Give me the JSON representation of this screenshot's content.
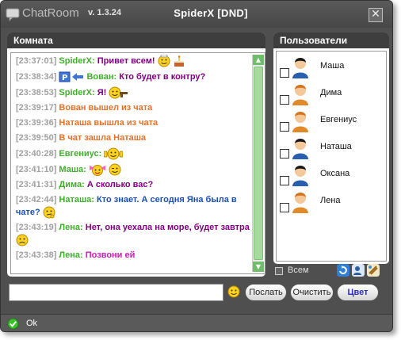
{
  "window": {
    "app_name": "ChatRoom",
    "version": "v. 1.3.24",
    "title_user": "SpiderX  [DND]",
    "close_glyph": "✕"
  },
  "room": {
    "title": "Комната",
    "messages": [
      {
        "time": "[23:37:01]",
        "nick": "SpiderX:",
        "text": "Привет всем!",
        "style": "purple",
        "icons": [
          "smiley-chef-icon",
          "cake-icon"
        ]
      },
      {
        "time": "[23:38:34]",
        "nick": "Вован:",
        "text": "Кто будет в контру?",
        "style": "purple",
        "prefix_icons": [
          "private-p-icon",
          "arrow-left-icon"
        ]
      },
      {
        "time": "[23:38:53]",
        "nick": "SpiderX:",
        "text": "Я!",
        "style": "purple",
        "icons": [
          "smiley-gun-icon"
        ]
      },
      {
        "time": "[23:39:17]",
        "text": "Вован вышел из чата",
        "style": "system"
      },
      {
        "time": "[23:39:36]",
        "text": "Наташа вышла из чата",
        "style": "system"
      },
      {
        "time": "[23:39:50]",
        "text": "В чат зашла Наташа",
        "style": "system"
      },
      {
        "time": "[23:40:28]",
        "nick": "Евгениус:",
        "text": "",
        "style": "purple",
        "icons": [
          "smiley-thumbs-up-icon"
        ]
      },
      {
        "time": "[23:41:10]",
        "nick": "Маша:",
        "text": "",
        "style": "purple",
        "icons": [
          "smiley-pink-bow-icon",
          "smiley-wink-icon"
        ]
      },
      {
        "time": "[23:41:31]",
        "nick": "Дима:",
        "text": "А сколько вас?",
        "style": "purple"
      },
      {
        "time": "[23:42:44]",
        "nick": "Наташа:",
        "text": "Кто знает. А сегодня Яна была в чате?",
        "style": "blue",
        "icons": [
          "smiley-thinking-icon"
        ]
      },
      {
        "time": "[23:43:19]",
        "nick": "Лена:",
        "text": "Нет, она уехала на море, будет завтра",
        "style": "purple",
        "icons": [
          "smiley-sad-icon"
        ]
      },
      {
        "time": "[23:43:38]",
        "nick": "Лена:",
        "text": "Позвони ей",
        "style": "magenta"
      }
    ]
  },
  "users": {
    "title": "Пользователи",
    "list": [
      {
        "name": "Маша",
        "avatar": "avatar-dark-icon"
      },
      {
        "name": "Дима",
        "avatar": "avatar-orange-icon"
      },
      {
        "name": "Евгениус",
        "avatar": "avatar-orange-icon"
      },
      {
        "name": "Наташа",
        "avatar": "avatar-dark-icon"
      },
      {
        "name": "Оксана",
        "avatar": "avatar-dark-icon"
      },
      {
        "name": "Лена",
        "avatar": "avatar-orange-icon"
      }
    ],
    "all_label": "Всем"
  },
  "composer": {
    "value": "",
    "send_label": "Послать",
    "clear_label": "Очистить",
    "color_label": "Цвет"
  },
  "status": {
    "text": "Ok"
  },
  "colors": {
    "nick": "#3fae2a",
    "system": "#e4712a",
    "time": "#a0a0a0",
    "text_purple": "#800080",
    "text_blue": "#1a4fb8",
    "text_magenta": "#cc19b8"
  }
}
